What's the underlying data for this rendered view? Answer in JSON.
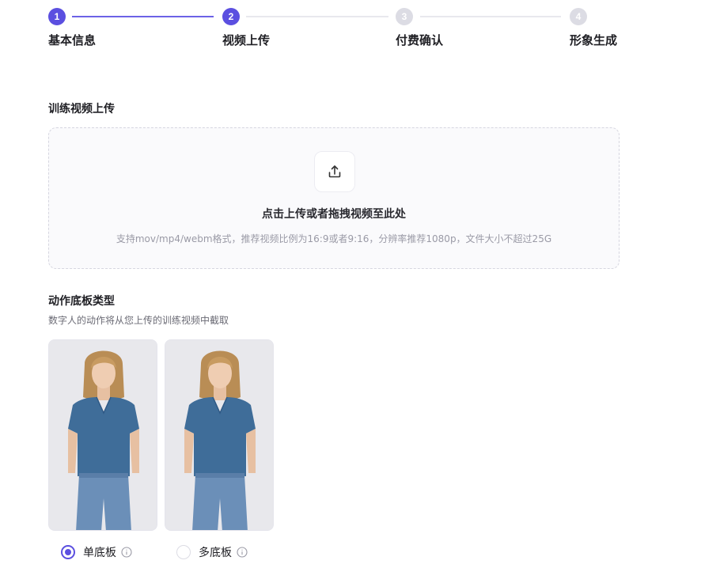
{
  "stepper": {
    "steps": [
      {
        "number": "1",
        "label": "基本信息",
        "state": "done"
      },
      {
        "number": "2",
        "label": "视频上传",
        "state": "active"
      },
      {
        "number": "3",
        "label": "付费确认",
        "state": "todo"
      },
      {
        "number": "4",
        "label": "形象生成",
        "state": "todo"
      }
    ]
  },
  "upload_section": {
    "title": "训练视频上传",
    "drop_title": "点击上传或者拖拽视频至此处",
    "drop_hint": "支持mov/mp4/webm格式，推荐视频比例为16:9或者9:16，分辨率推荐1080p，文件大小不超过25G",
    "icon": "upload-icon"
  },
  "template_section": {
    "title": "动作底板类型",
    "subtitle": "数字人的动作将从您上传的训练视频中截取",
    "options": [
      {
        "label": "单底板",
        "selected": true
      },
      {
        "label": "多底板",
        "selected": false
      }
    ]
  },
  "colors": {
    "accent": "#5b4fe0",
    "inactive": "#dcdce4"
  }
}
